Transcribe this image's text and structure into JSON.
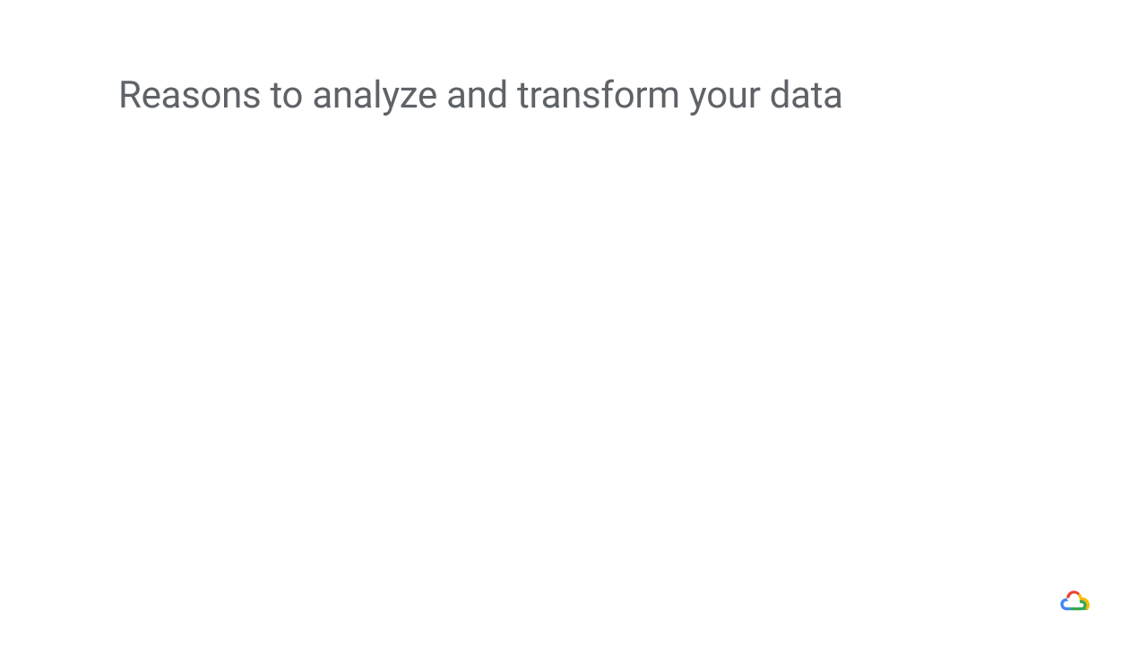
{
  "slide": {
    "title": "Reasons to analyze and transform your data"
  },
  "branding": {
    "logo_name": "google-cloud-logo"
  }
}
